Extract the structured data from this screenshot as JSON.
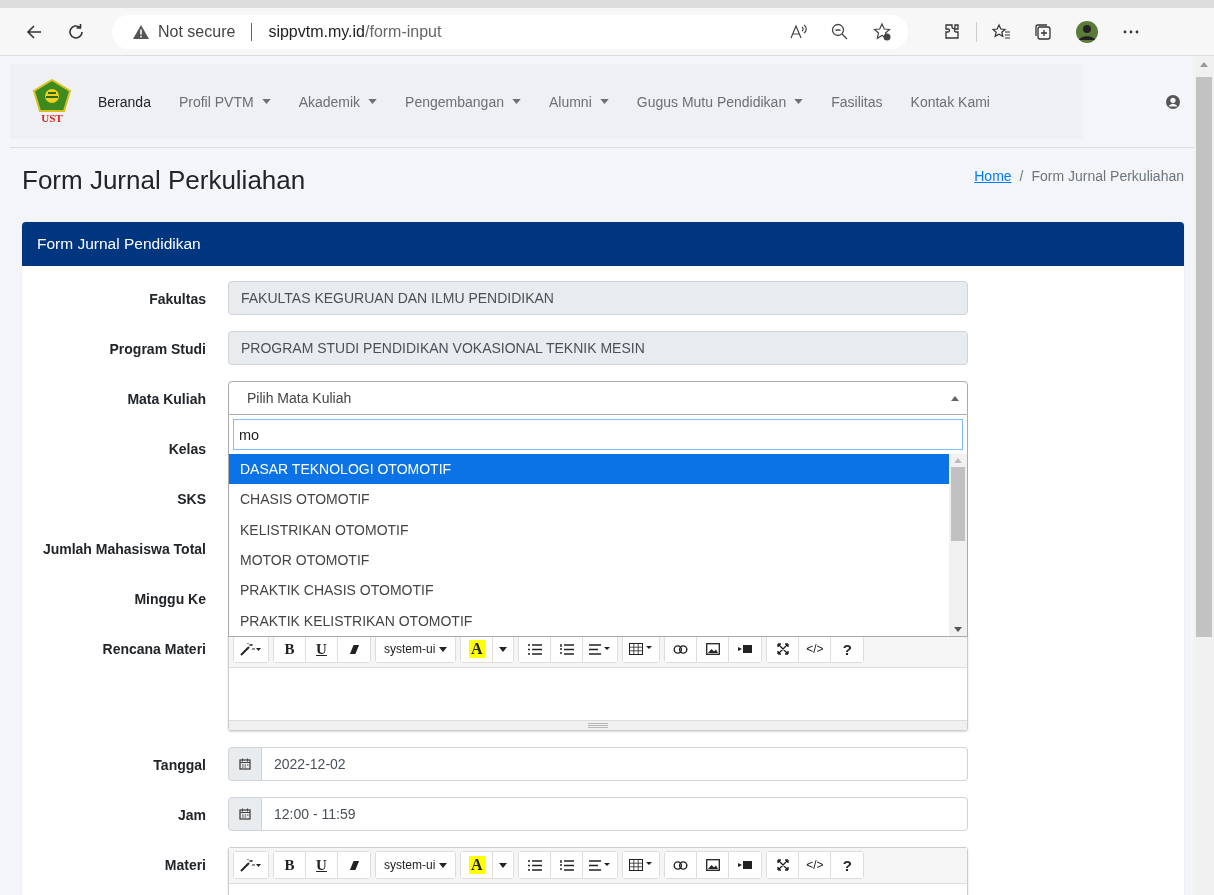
{
  "browser": {
    "security_label": "Not secure",
    "url_domain": "sippvtm.my.id",
    "url_path": "/form-input"
  },
  "navbar": {
    "logo_text": "UST",
    "items": [
      {
        "label": "Beranda",
        "dropdown": false,
        "selected": true
      },
      {
        "label": "Profil PVTM",
        "dropdown": true,
        "selected": false
      },
      {
        "label": "Akademik",
        "dropdown": true,
        "selected": false
      },
      {
        "label": "Pengembangan",
        "dropdown": true,
        "selected": false
      },
      {
        "label": "Alumni",
        "dropdown": true,
        "selected": false
      },
      {
        "label": "Gugus Mutu Pendidikan",
        "dropdown": true,
        "selected": false
      },
      {
        "label": "Fasilitas",
        "dropdown": false,
        "selected": false
      },
      {
        "label": "Kontak Kami",
        "dropdown": false,
        "selected": false
      }
    ]
  },
  "page": {
    "title": "Form Jurnal Perkuliahan",
    "breadcrumb": {
      "home": "Home",
      "separator": "/",
      "current": "Form Jurnal Perkuliahan"
    }
  },
  "card": {
    "title": "Form Jurnal Pendidikan",
    "fields": [
      {
        "label": "Fakultas",
        "kind": "readonly",
        "value": "FAKULTAS KEGURUAN DAN ILMU PENDIDIKAN"
      },
      {
        "label": "Program Studi",
        "kind": "readonly",
        "value": "PROGRAM STUDI PENDIDIKAN VOKASIONAL TEKNIK MESIN"
      },
      {
        "label": "Mata Kuliah",
        "kind": "select",
        "placeholder": "Pilih Mata Kuliah",
        "search_value": "mo",
        "options": [
          {
            "label": "DASAR TEKNOLOGI OTOMOTIF",
            "selected": true
          },
          {
            "label": "CHASIS OTOMOTIF",
            "selected": false
          },
          {
            "label": "KELISTRIKAN OTOMOTIF",
            "selected": false
          },
          {
            "label": "MOTOR OTOMOTIF",
            "selected": false
          },
          {
            "label": "PRAKTIK CHASIS OTOMOTIF",
            "selected": false
          },
          {
            "label": "PRAKTIK KELISTRIKAN OTOMOTIF",
            "selected": false
          }
        ]
      },
      {
        "label": "Kelas",
        "kind": "covered"
      },
      {
        "label": "SKS",
        "kind": "covered"
      },
      {
        "label": "Jumlah Mahasiswa Total",
        "kind": "covered"
      },
      {
        "label": "Minggu Ke",
        "kind": "covered"
      },
      {
        "label": "Rencana Materi",
        "kind": "editor",
        "toolbar": {
          "bold": "B",
          "underline": "U",
          "font": "system-ui",
          "text_color": "A",
          "code": "</>",
          "help": "?"
        }
      },
      {
        "label": "Tanggal",
        "kind": "date",
        "value": "2022-12-02"
      },
      {
        "label": "Jam",
        "kind": "date",
        "value": "12:00 - 11:59"
      },
      {
        "label": "Materi",
        "kind": "editor",
        "toolbar": {
          "bold": "B",
          "underline": "U",
          "font": "system-ui",
          "text_color": "A",
          "code": "</>",
          "help": "?"
        }
      }
    ]
  }
}
